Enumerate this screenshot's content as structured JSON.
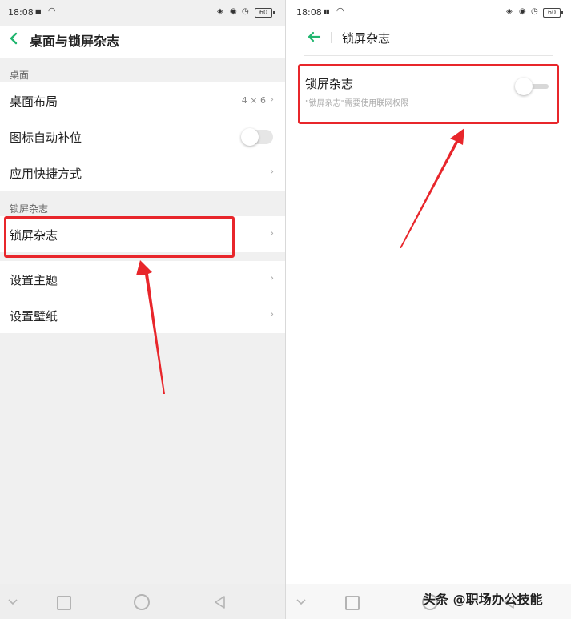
{
  "status": {
    "time": "18:08",
    "battery": "60"
  },
  "left": {
    "title": "桌面与锁屏杂志",
    "section_desktop": "桌面",
    "rows": [
      {
        "label": "桌面布局",
        "value": "4 × 6"
      },
      {
        "label": "图标自动补位"
      },
      {
        "label": "应用快捷方式"
      }
    ],
    "section_lock": "锁屏杂志",
    "lock_row": {
      "label": "锁屏杂志"
    },
    "rows2": [
      {
        "label": "设置主题"
      },
      {
        "label": "设置壁纸"
      }
    ]
  },
  "right": {
    "title": "锁屏杂志",
    "setting_title": "锁屏杂志",
    "setting_desc": "\"锁屏杂志\"需要使用联网权限"
  },
  "icons": {
    "back_left": "chevron-left-icon",
    "back_right": "arrow-left-icon",
    "chevron": "›"
  },
  "colors": {
    "accent": "#1fb56e",
    "highlight": "#e8262b"
  },
  "watermark": "头条 @职场办公技能"
}
